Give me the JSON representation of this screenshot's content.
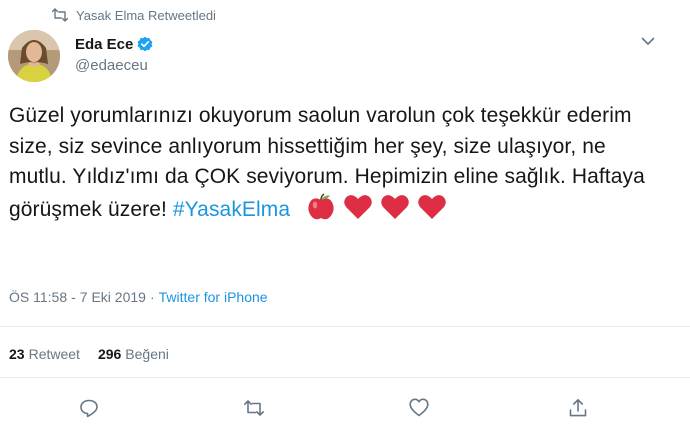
{
  "retweet_context": {
    "text": "Yasak Elma Retweetledi",
    "icon": "retweet-icon"
  },
  "author": {
    "display_name": "Eda Ece",
    "handle": "@edaeceu",
    "verified": true,
    "avatar": "profile-photo"
  },
  "tweet": {
    "text_before": "Güzel yorumlarınızı okuyorum saolun varolun çok teşekkür ederim size, siz sevince anlıyorum hissettiğim her şey, size ulaşıyor, ne mutlu. Yıldız'ımı da ÇOK seviyorum. Hepimizin eline sağlık. Haftaya görüşmek üzere! ",
    "hashtag": "#YasakElma",
    "emojis": [
      "red-apple",
      "red-heart",
      "red-heart",
      "red-heart"
    ]
  },
  "meta": {
    "time": "ÖS 11:58",
    "separator1": "-",
    "date": "7 Eki 2019",
    "separator2": "·",
    "source": "Twitter for iPhone"
  },
  "stats": {
    "retweets": {
      "count": "23",
      "label": "Retweet"
    },
    "likes": {
      "count": "296",
      "label": "Beğeni"
    }
  },
  "actions": [
    "reply-icon",
    "retweet-icon",
    "like-icon",
    "share-icon"
  ],
  "colors": {
    "link": "#1b95e0",
    "muted": "#657786",
    "text": "#14171a",
    "divider": "#e6ecf0",
    "heart": "#e0245e",
    "verified": "#1da1f2"
  }
}
